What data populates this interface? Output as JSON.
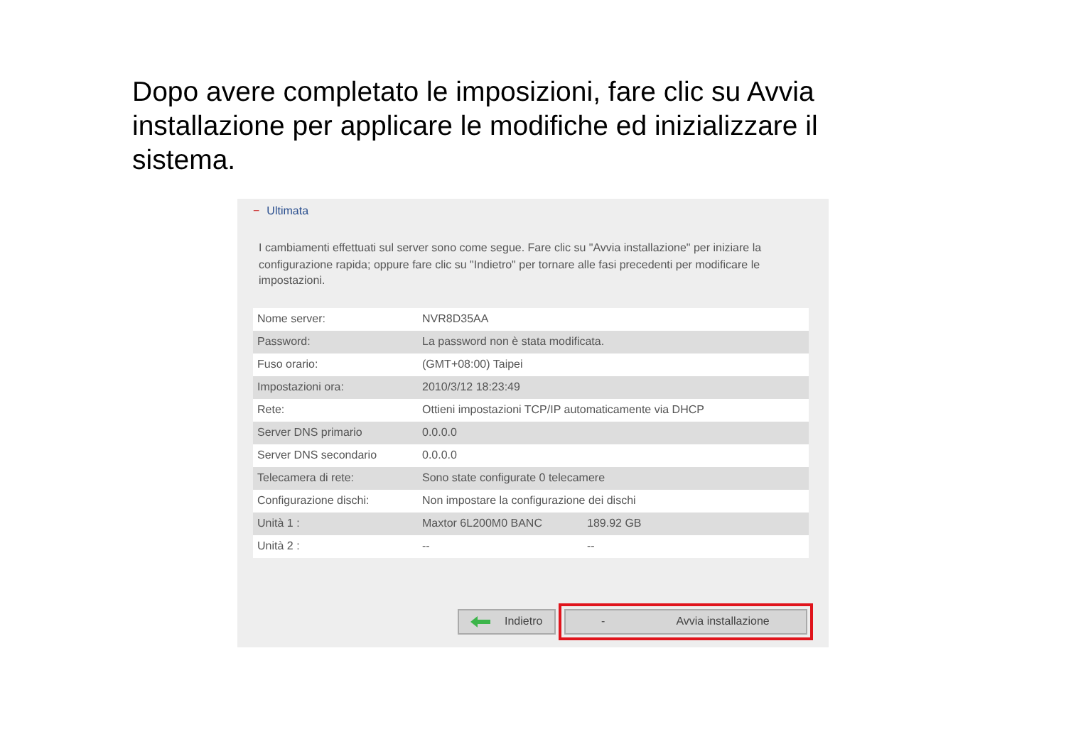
{
  "caption": "Dopo avere completato le imposizioni, fare clic su Avvia installazione per applicare le modifiche ed inizializzare il sistema.",
  "panel": {
    "toggle": "−",
    "title": "Ultimata",
    "description": "I cambiamenti effettuati sul server sono come segue. Fare clic su \"Avvia installazione\" per iniziare la configurazione rapida; oppure fare clic su \"Indietro\" per tornare alle fasi precedenti per modificare le impostazioni.",
    "rows": [
      {
        "label": "Nome server:",
        "values": [
          "NVR8D35AA"
        ]
      },
      {
        "label": "Password:",
        "values": [
          "La password non è stata modificata."
        ]
      },
      {
        "label": "Fuso orario:",
        "values": [
          "(GMT+08:00) Taipei"
        ]
      },
      {
        "label": "Impostazioni ora:",
        "values": [
          "2010/3/12 18:23:49"
        ]
      },
      {
        "label": "Rete:",
        "values": [
          "Ottieni impostazioni TCP/IP automaticamente via DHCP"
        ]
      },
      {
        "label": "Server DNS primario",
        "values": [
          "0.0.0.0"
        ]
      },
      {
        "label": "Server DNS secondario",
        "values": [
          "0.0.0.0"
        ]
      },
      {
        "label": "Telecamera di rete:",
        "values": [
          "Sono state configurate 0 telecamere"
        ]
      },
      {
        "label": "Configurazione dischi:",
        "values": [
          "Non impostare la configurazione dei dischi"
        ]
      },
      {
        "label": "Unità 1 :",
        "values": [
          "Maxtor 6L200M0 BANC",
          "189.92 GB"
        ]
      },
      {
        "label": "Unità 2 :",
        "values": [
          "--",
          "--"
        ]
      }
    ],
    "buttons": [
      {
        "kind": "back",
        "label": "Indietro",
        "highlighted": false
      },
      {
        "kind": "install",
        "icon_text": "-",
        "label": "Avvia installazione",
        "highlighted": true
      }
    ]
  }
}
